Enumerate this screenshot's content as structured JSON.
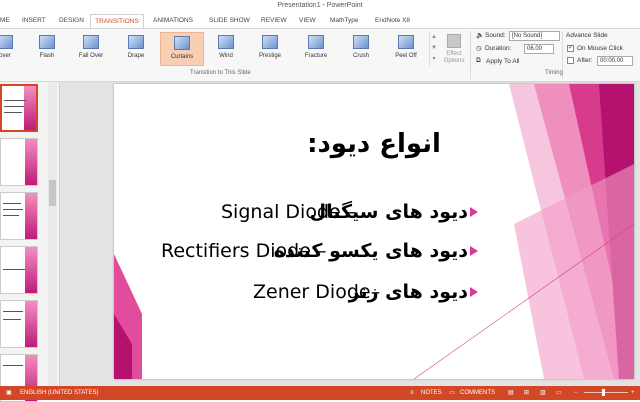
{
  "window": {
    "title": "Presentation1 - PowerPoint"
  },
  "tabs": [
    "ME",
    "INSERT",
    "DESIGN",
    "TRANSITIONS",
    "ANIMATIONS",
    "SLIDE SHOW",
    "REVIEW",
    "VIEW",
    "MathType",
    "EndNote X8"
  ],
  "active_tab": "TRANSITIONS",
  "ribbon": {
    "transitions": [
      "over",
      "Flash",
      "Fall Over",
      "Drape",
      "Curtains",
      "Wind",
      "Prestige",
      "Fracture",
      "Crush",
      "Peel Off"
    ],
    "selected_transition": "Curtains",
    "effect_options_label": "Effect Options",
    "group_transition_label": "Transition to This Slide",
    "group_timing_label": "Timing",
    "sound_label": "Sound:",
    "sound_value": "[No Sound]",
    "duration_label": "Duration:",
    "duration_value": "06.00",
    "apply_all_label": "Apply To All",
    "advance_label": "Advance Slide",
    "on_mouse_click_label": "On Mouse Click",
    "on_mouse_click_checked": true,
    "after_label": "After:",
    "after_value": "00:00.00",
    "after_checked": false
  },
  "slide": {
    "title": "انواع دیود:",
    "bullets": [
      {
        "ar": "دیود های سیگنال",
        "en": "Signal Diode –"
      },
      {
        "ar": "دیود های یکسو کننده",
        "en": "Rectifiers Diode –"
      },
      {
        "ar": "دیود های زنر",
        "en": "Zener Diode–"
      }
    ]
  },
  "status": {
    "language": "ENGLISH (UNITED STATES)",
    "notes": "NOTES",
    "comments": "COMMENTS"
  },
  "colors": {
    "accent": "#d24726",
    "slide_pink": "#e0359b"
  }
}
